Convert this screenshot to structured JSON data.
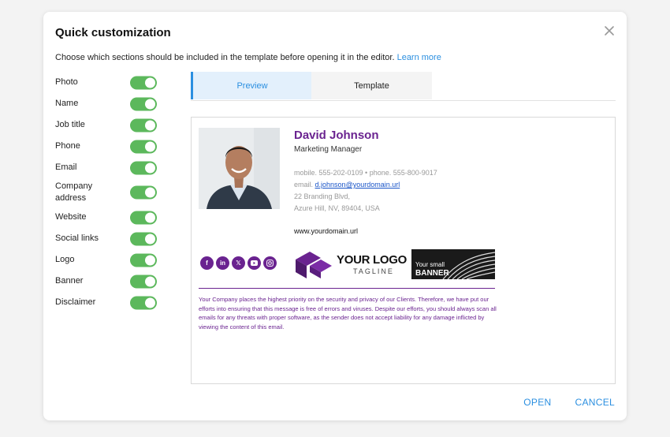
{
  "dialog": {
    "title": "Quick customization",
    "subtitle": "Choose which sections should be included in the template before opening it in the editor.",
    "learn_more": "Learn more"
  },
  "toggles": [
    {
      "label": "Photo",
      "on": true
    },
    {
      "label": "Name",
      "on": true
    },
    {
      "label": "Job title",
      "on": true
    },
    {
      "label": "Phone",
      "on": true
    },
    {
      "label": "Email",
      "on": true
    },
    {
      "label": "Company address",
      "on": true
    },
    {
      "label": "Website",
      "on": true
    },
    {
      "label": "Social links",
      "on": true
    },
    {
      "label": "Logo",
      "on": true
    },
    {
      "label": "Banner",
      "on": true
    },
    {
      "label": "Disclaimer",
      "on": true
    }
  ],
  "tabs": [
    {
      "label": "Preview",
      "active": true
    },
    {
      "label": "Template",
      "active": false
    }
  ],
  "signature": {
    "name": "David Johnson",
    "job_title": "Marketing Manager",
    "phones": "mobile. 555-202-0109 • phone. 555-800-9017",
    "email_prefix": "email.",
    "email": "d.johnson@yourdomain.url",
    "address_line1": "22 Branding Blvd,",
    "address_line2": "Azure Hill, NV, 89404, USA",
    "website": "www.yourdomain.url",
    "socials": [
      "facebook-icon",
      "linkedin-icon",
      "x-icon",
      "youtube-icon",
      "instagram-icon"
    ],
    "logo_text": "YOUR LOGO",
    "logo_tagline": "TAGLINE",
    "banner_line1": "Your small",
    "banner_line2": "BANNER",
    "disclaimer": "Your Company places the highest priority on the security and privacy of our Clients. Therefore, we have put our efforts into ensuring that this message is free of errors and viruses. Despite our efforts, you should always scan all emails for any threats with proper software, as the sender does not accept liability for any damage inflicted by viewing the content of this email."
  },
  "actions": {
    "open": "OPEN",
    "cancel": "CANCEL"
  },
  "colors": {
    "accent": "#2b8fe0",
    "toggle_on": "#5cb85c",
    "brand_purple": "#6a2390"
  }
}
